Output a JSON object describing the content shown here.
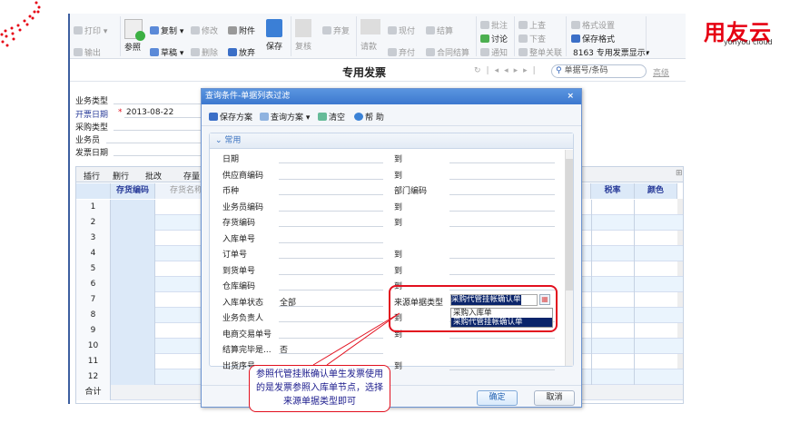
{
  "toolbar": {
    "print": "打印",
    "export": "输出",
    "reference": "参照",
    "copy": "复制",
    "modify": "修改",
    "attach": "附件",
    "save": "保存",
    "draft": "草稿",
    "delete": "删除",
    "abandon": "放弃",
    "review": "复核",
    "abandon_review": "弃复",
    "request": "请款",
    "cash_pay": "现付",
    "settle": "结算",
    "abandon_pay": "弃付",
    "contract_settle": "合同结算",
    "annotate": "批注",
    "discuss": "讨论",
    "notify": "通知",
    "up_query": "上查",
    "down_query": "下查",
    "doc_link": "整单关联",
    "format_settings": "格式设置",
    "save_format": "保存格式",
    "format_select": "8163 专用发票显示"
  },
  "header": {
    "title": "专用发票",
    "search_placeholder": "单据号/条码",
    "advanced": "高级"
  },
  "brand": {
    "name": "用友云",
    "sub": "yonyou cloud",
    "color": "#e60012"
  },
  "form": {
    "fields": [
      {
        "label": "业务类型",
        "value": ""
      },
      {
        "label": "开票日期",
        "value": "2013-08-22",
        "required": true
      },
      {
        "label": "采购类型",
        "value": ""
      },
      {
        "label": "业务员",
        "value": ""
      },
      {
        "label": "发票日期",
        "value": ""
      }
    ]
  },
  "grid": {
    "actions": [
      "插行",
      "删行",
      "批改",
      "存量"
    ],
    "columns": [
      "存货编码",
      "存货名称",
      "税率",
      "颜色"
    ],
    "rows": [
      "1",
      "2",
      "3",
      "4",
      "5",
      "6",
      "7",
      "8",
      "9",
      "10",
      "11",
      "12"
    ],
    "total": "合计"
  },
  "dialog": {
    "title": "查询条件-单据列表过滤",
    "close": "×",
    "tools": {
      "save_plan": "保存方案",
      "query_plan": "查询方案",
      "clear": "清空",
      "help": "帮 助"
    },
    "section": "常用",
    "rows": [
      {
        "l": "日期",
        "v": "",
        "r": "到",
        "rv": ""
      },
      {
        "l": "供应商编码",
        "v": "",
        "r": "到",
        "rv": ""
      },
      {
        "l": "币种",
        "v": "",
        "r": "部门编码",
        "rv": ""
      },
      {
        "l": "业务员编码",
        "v": "",
        "r": "到",
        "rv": ""
      },
      {
        "l": "存货编码",
        "v": "",
        "r": "到",
        "rv": ""
      },
      {
        "l": "入库单号",
        "v": "",
        "r": "",
        "rv": ""
      },
      {
        "l": "订单号",
        "v": "",
        "r": "到",
        "rv": ""
      },
      {
        "l": "到货单号",
        "v": "",
        "r": "到",
        "rv": ""
      },
      {
        "l": "仓库编码",
        "v": "",
        "r": "到",
        "rv": ""
      },
      {
        "l": "入库单状态",
        "v": "全部",
        "r": "来源单据类型",
        "rv": "采购代管挂帐确认单"
      },
      {
        "l": "业务负责人",
        "v": "",
        "r": "到",
        "rv": ""
      },
      {
        "l": "电商交易单号",
        "v": "",
        "r": "到",
        "rv": ""
      },
      {
        "l": "结算完毕是...",
        "v": "否",
        "r": "",
        "rv": ""
      },
      {
        "l": "出货序号",
        "v": "",
        "r": "到",
        "rv": ""
      }
    ],
    "dropdown_options": [
      "采购入库单",
      "采购代管挂帐确认单"
    ],
    "selected_option": "采购代管挂帐确认单",
    "ok": "确定",
    "cancel": "取消"
  },
  "callout": "参照代管挂账确认单生发票使用的是发票参照入库单节点，选择来源单据类型即可"
}
